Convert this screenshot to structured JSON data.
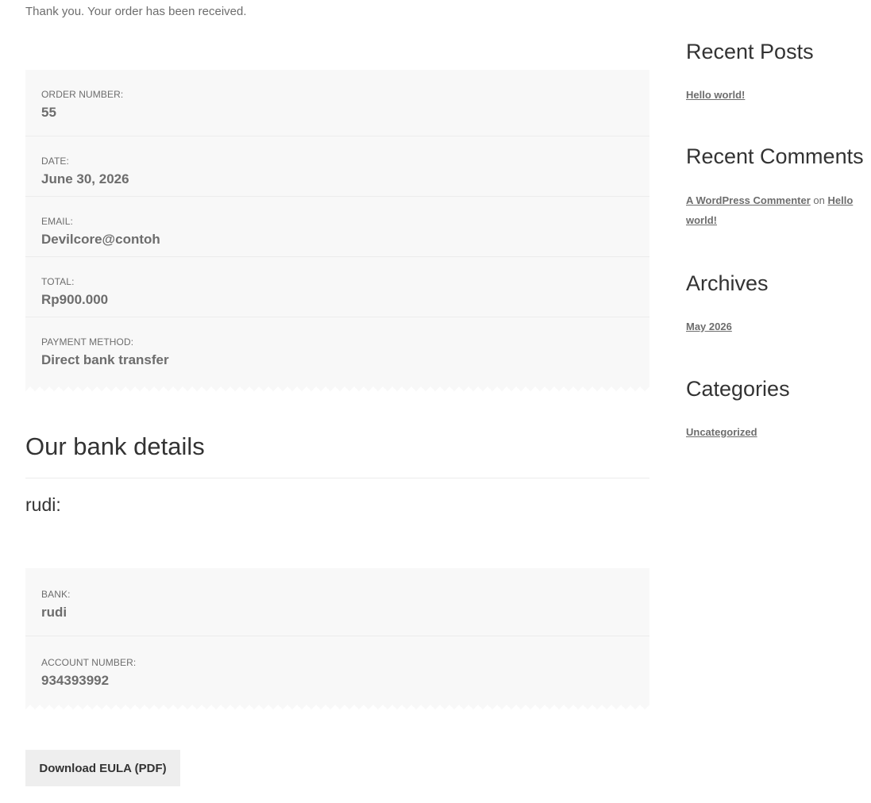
{
  "notice": "Thank you. Your order has been received.",
  "order_overview": [
    {
      "label": "ORDER NUMBER:",
      "value": "55"
    },
    {
      "label": "DATE:",
      "value": "June 30, 2026"
    },
    {
      "label": "EMAIL:",
      "value": "Devilcore@contoh"
    },
    {
      "label": "TOTAL:",
      "value": "Rp900.000"
    },
    {
      "label": "PAYMENT METHOD:",
      "value": "Direct bank transfer"
    }
  ],
  "bank_details": {
    "heading": "Our bank details",
    "account_name": "rudi:",
    "rows": [
      {
        "label": "BANK:",
        "value": "rudi"
      },
      {
        "label": "ACCOUNT NUMBER:",
        "value": "934393992"
      }
    ]
  },
  "download_button": "Download EULA (PDF)",
  "sidebar": {
    "recent_posts": {
      "title": "Recent Posts",
      "items": [
        "Hello world!"
      ]
    },
    "recent_comments": {
      "title": "Recent Comments",
      "author": "A WordPress Commenter",
      "connector": "on",
      "post": "Hello world!"
    },
    "archives": {
      "title": "Archives",
      "items": [
        "May 2026"
      ]
    },
    "categories": {
      "title": "Categories",
      "items": [
        "Uncategorized"
      ]
    }
  },
  "colors": {
    "text": "#6d6d6d",
    "heading": "#333333",
    "box_background": "#f8f8f8",
    "button_background": "#eeeeee"
  }
}
